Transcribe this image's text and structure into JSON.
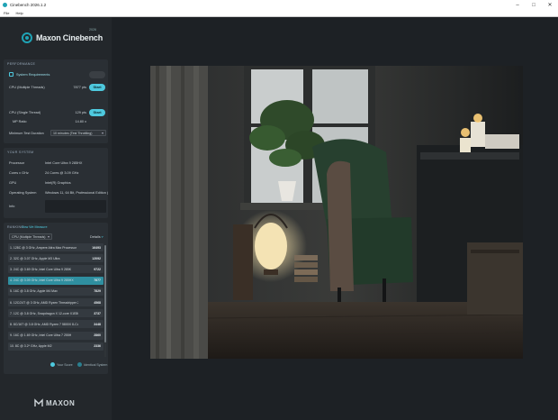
{
  "window": {
    "title": "Cinebench 2026.1.2"
  },
  "menu": [
    "File",
    "Help"
  ],
  "logo": {
    "text": "Maxon Cinebench",
    "version": "2026"
  },
  "performance": {
    "title": "PERFORMANCE",
    "system_requirements": "System Requirements",
    "cpu_multi_label": "CPU (Multiple Threads)",
    "cpu_multi_pts": "7877 pts",
    "cpu_single_label": "CPU (Single Thread)",
    "cpu_single_pts": "129 pts",
    "mp_ratio_label": "MP Ratio",
    "mp_ratio_value": "14.80 x",
    "start_label": "Start",
    "min_duration_label": "Minimum Test Duration",
    "min_duration_value": "10 minutes (Test Throttling)"
  },
  "your_system": {
    "title": "YOUR SYSTEM",
    "processor_label": "Processor",
    "processor_value": "Intel Core Ultra 9 285HX",
    "cores_label": "Cores x GHz",
    "cores_value": "24 Cores @ 3.09 GHz",
    "gpu_label": "GPU",
    "gpu_value": "Intel(R) Graphics",
    "os_label": "Operating System",
    "os_value": "Windows 11, 64 Bit, Professional Edition (b...",
    "info_label": "Info"
  },
  "ranking": {
    "title": "RANKING",
    "link": "How We Measure",
    "select_value": "CPU (Multiple Threads)",
    "details_label": "Details",
    "rows": [
      {
        "label": "1. 128C @ 3 GHz, Ampere Altra Max Processor",
        "score": "16493"
      },
      {
        "label": "2. 32C @ 3.07 GHz, Apple M3 Ultra",
        "score": "12092"
      },
      {
        "label": "3. 24C @ 3.69 GHz, Intel Core Ultra 9 285K",
        "score": "9722"
      },
      {
        "label": "4. 24C @ 3.09 GHz, Intel Core Ultra 9 285HX",
        "score": "7877",
        "highlight": true
      },
      {
        "label": "5. 16C @ 3.8 GHz, Apple M4 Max",
        "score": "7829"
      },
      {
        "label": "6. 12C/24T @ 3 GHz, AMD Ryzen Threadripper 2990...",
        "score": "4568"
      },
      {
        "label": "7. 12C @ 3.8 GHz, Snapdragon X 12-core X1E80100",
        "score": "3737"
      },
      {
        "label": "8. 8C/16T @ 3.8 GHz, AMD Ryzen 7 5800X 8-Core Pr...",
        "score": "3448"
      },
      {
        "label": "9. 16C @ 1.69 GHz, Intel Core Ultra 7 255H",
        "score": "2860"
      },
      {
        "label": "10. 8C @ 3.2* GHz, Apple M2",
        "score": "2336"
      }
    ]
  },
  "legend": {
    "your_score": "Your Score",
    "identical_system": "Identical System",
    "your_score_color": "#4ec9de",
    "identical_color": "#2b7f8f"
  },
  "footer": {
    "brand": "MAXON"
  },
  "colors": {
    "accent": "#4ec9de",
    "panel": "#23272b",
    "background": "#1d2125"
  }
}
